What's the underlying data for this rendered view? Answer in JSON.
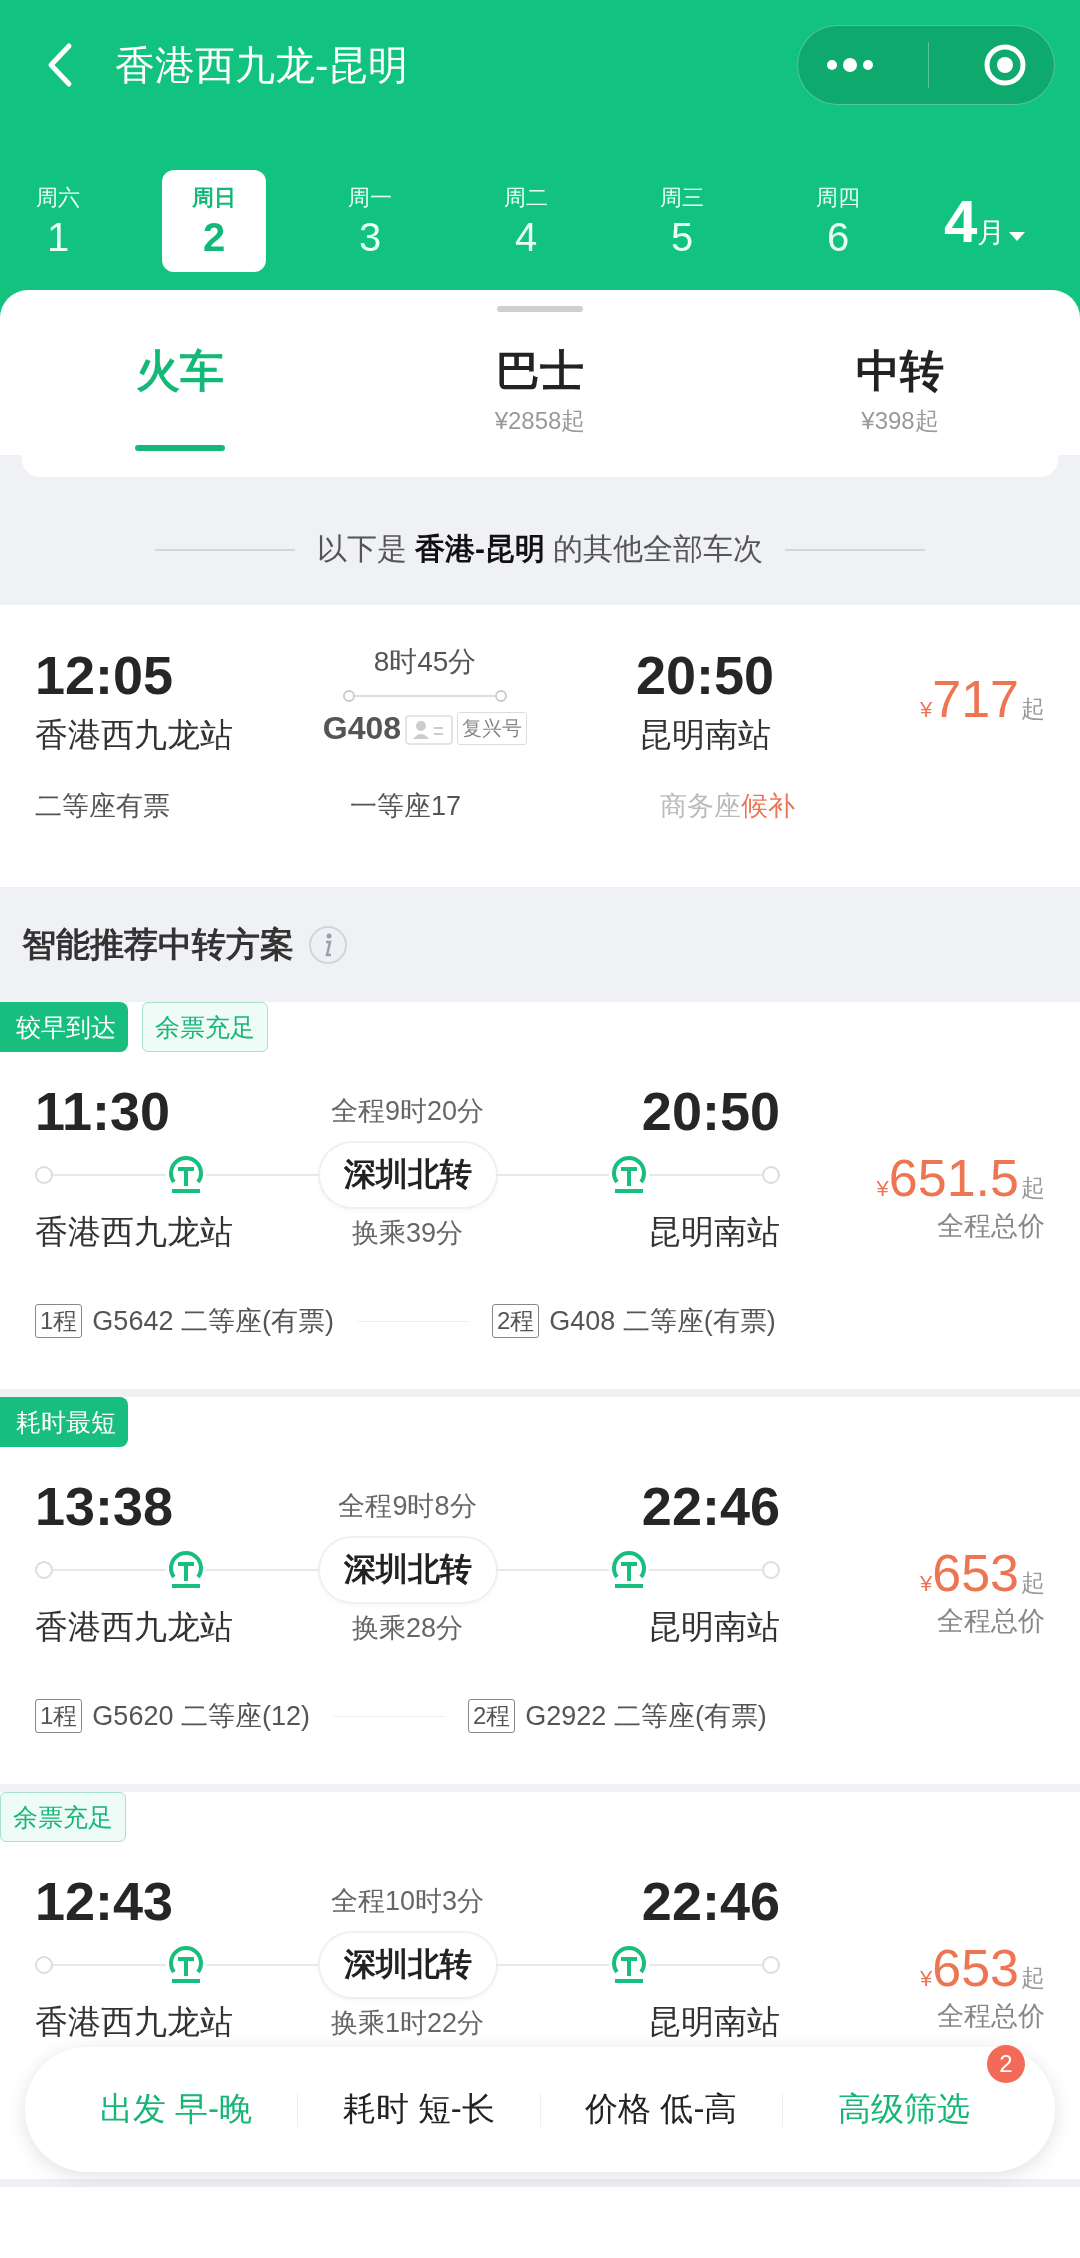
{
  "header": {
    "title": "香港西九龙-昆明"
  },
  "dates": [
    {
      "weekday": "周六",
      "day": "1",
      "selected": false
    },
    {
      "weekday": "周日",
      "day": "2",
      "selected": true
    },
    {
      "weekday": "周一",
      "day": "3",
      "selected": false
    },
    {
      "weekday": "周二",
      "day": "4",
      "selected": false
    },
    {
      "weekday": "周三",
      "day": "5",
      "selected": false
    },
    {
      "weekday": "周四",
      "day": "6",
      "selected": false
    }
  ],
  "month": {
    "number": "4",
    "unit": "月"
  },
  "tabs": [
    {
      "label": "火车",
      "selected": true
    },
    {
      "label": "巴士",
      "price": "¥2858起",
      "selected": false
    },
    {
      "label": "中转",
      "price": "¥398起",
      "selected": false
    }
  ],
  "divider_text": "以下是 **香港-昆明** 的其他全部车次",
  "direct_train": {
    "depart": "12:05",
    "duration": "8时45分",
    "arrive": "20:50",
    "from": "香港西九龙站",
    "train_no": "G408",
    "train_tag": "复兴号",
    "to": "昆明南站",
    "currency": "¥",
    "price": "717",
    "price_suffix": "起",
    "seats": [
      {
        "class": "二等座",
        "status": "有票",
        "available": true
      },
      {
        "class": "一等座",
        "status": "17",
        "available": true
      },
      {
        "class": "商务座",
        "status": "候补",
        "available": false
      }
    ]
  },
  "transfer_section": {
    "title": "智能推荐中转方案"
  },
  "transfers": [
    {
      "badges": [
        {
          "label": "较早到达",
          "kind": "solid"
        },
        {
          "label": "余票充足",
          "kind": "outline"
        }
      ],
      "depart": "11:30",
      "total": "全程9时20分",
      "arrive": "20:50",
      "via": "深圳北转",
      "from": "香港西九龙站",
      "wait": "换乘39分",
      "to": "昆明南站",
      "currency": "¥",
      "price": "651.5",
      "price_suffix": "起",
      "price_note": "全程总价",
      "legs": [
        {
          "tag": "1程",
          "text": "G5642 二等座(有票)"
        },
        {
          "tag": "2程",
          "text": "G408 二等座(有票)"
        }
      ]
    },
    {
      "badges": [
        {
          "label": "耗时最短",
          "kind": "solid"
        }
      ],
      "depart": "13:38",
      "total": "全程9时8分",
      "arrive": "22:46",
      "via": "深圳北转",
      "from": "香港西九龙站",
      "wait": "换乘28分",
      "to": "昆明南站",
      "currency": "¥",
      "price": "653",
      "price_suffix": "起",
      "price_note": "全程总价",
      "legs": [
        {
          "tag": "1程",
          "text": "G5620 二等座(12)"
        },
        {
          "tag": "2程",
          "text": "G2922 二等座(有票)"
        }
      ]
    },
    {
      "badges": [
        {
          "label": "余票充足",
          "kind": "outline"
        }
      ],
      "depart": "12:43",
      "total": "全程10时3分",
      "arrive": "22:46",
      "via": "深圳北转",
      "from": "香港西九龙站",
      "wait": "换乘1时22分",
      "to": "昆明南站",
      "currency": "¥",
      "price": "653",
      "price_suffix": "起",
      "price_note": "全程总价"
    }
  ],
  "filter_bar": {
    "items": [
      {
        "label": "出发 早-晚",
        "highlighted": true
      },
      {
        "label": "耗时 短-长",
        "highlighted": false
      },
      {
        "label": "价格 低-高",
        "highlighted": false
      },
      {
        "label": "高级筛选",
        "highlighted": true,
        "badge": "2"
      }
    ]
  }
}
